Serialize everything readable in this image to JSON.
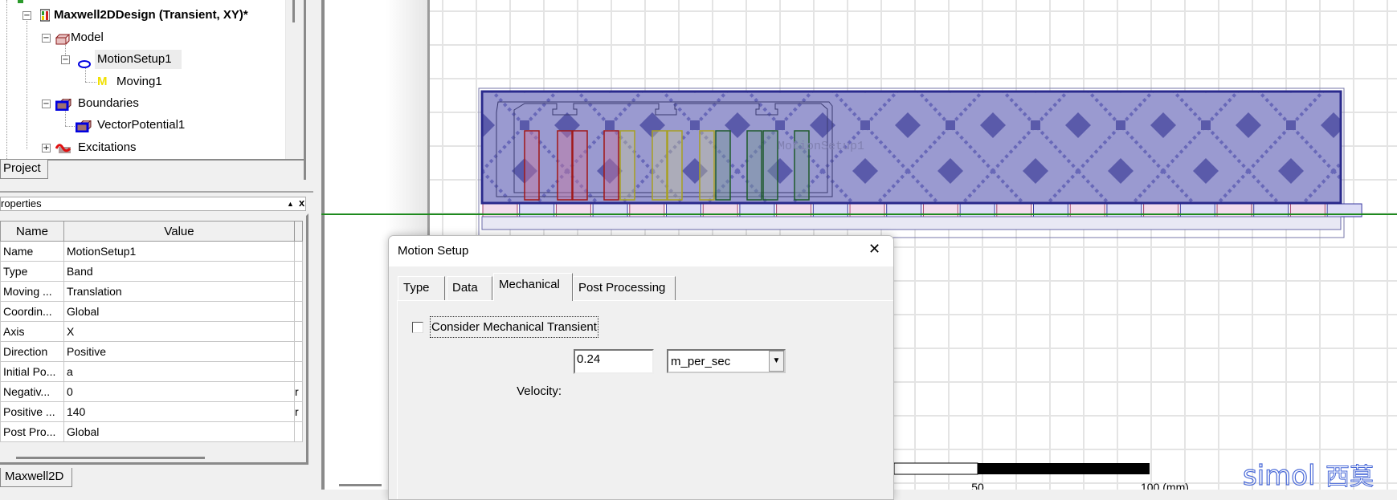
{
  "tree": {
    "design": "Maxwell2DDesign (Transient, XY)*",
    "items": [
      {
        "label": "Model"
      },
      {
        "label": "MotionSetup1"
      },
      {
        "label": "Moving1"
      },
      {
        "label": "Boundaries"
      },
      {
        "label": "VectorPotential1"
      },
      {
        "label": "Excitations"
      }
    ],
    "moving_icon_glyph": "M"
  },
  "project_tab": "Project",
  "properties": {
    "title": "roperties",
    "pin": "▲",
    "close": "x",
    "columns": [
      "Name",
      "Value"
    ],
    "rows": [
      {
        "name": "Name",
        "value": "MotionSetup1",
        "unit": ""
      },
      {
        "name": "Type",
        "value": "Band",
        "unit": ""
      },
      {
        "name": "Moving ...",
        "value": "Translation",
        "unit": ""
      },
      {
        "name": "Coordin...",
        "value": "Global",
        "unit": ""
      },
      {
        "name": "Axis",
        "value": "X",
        "unit": ""
      },
      {
        "name": "Direction",
        "value": "Positive",
        "unit": ""
      },
      {
        "name": "Initial Po...",
        "value": "a",
        "unit": ""
      },
      {
        "name": "Negativ...",
        "value": "0",
        "unit": "r"
      },
      {
        "name": "Positive ...",
        "value": "140",
        "unit": "r"
      },
      {
        "name": "Post Pro...",
        "value": "Global",
        "unit": ""
      }
    ]
  },
  "bottom_tab": "Maxwell2D",
  "model": {
    "band_label": "MotionSetup1",
    "colors": {
      "band": "#9a9ad0",
      "band_edge": "#2a2a8c",
      "phase_a": "#a01818",
      "phase_b": "#a8a020",
      "phase_c": "#1e5a2a",
      "axis": "#1e8a1e"
    }
  },
  "scale_bar": {
    "labels": [
      "50",
      "100 (mm)"
    ]
  },
  "logo": {
    "text": "simol",
    "cn": "西莫"
  },
  "dialog": {
    "title": "Motion Setup",
    "close": "✕",
    "tabs": [
      "Type",
      "Data",
      "Mechanical",
      "Post Processing"
    ],
    "active_tab": "Mechanical",
    "checkbox_label": "Consider Mechanical Transient",
    "checkbox_checked": false,
    "velocity_label": "Velocity:",
    "velocity_value": "0.24",
    "velocity_unit": "m_per_sec"
  }
}
